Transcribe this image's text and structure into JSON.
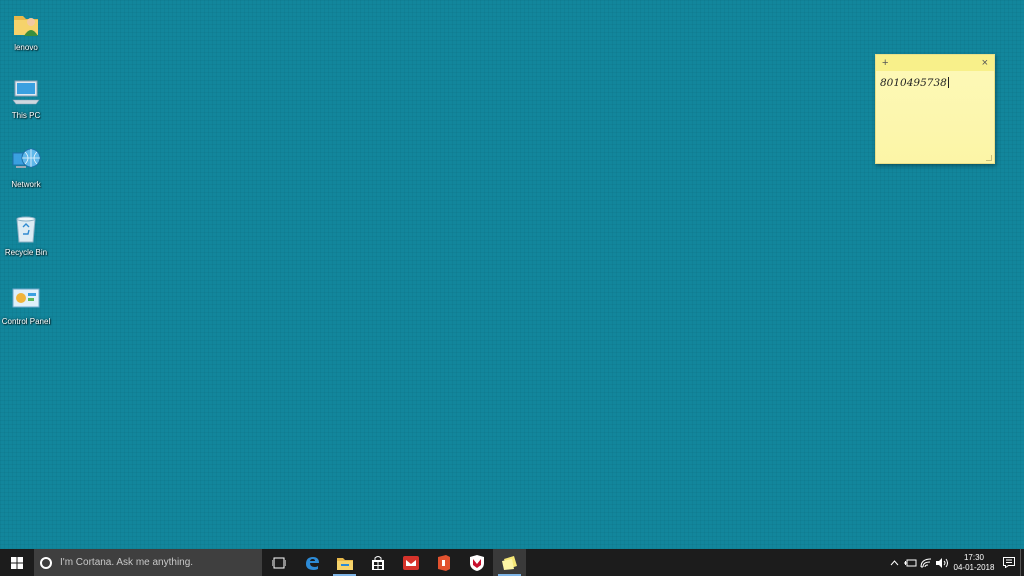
{
  "desktop": {
    "icons": [
      {
        "label": "lenovo"
      },
      {
        "label": "This PC"
      },
      {
        "label": "Network"
      },
      {
        "label": "Recycle Bin"
      },
      {
        "label": "Control Panel"
      }
    ]
  },
  "sticky_note": {
    "add_label": "+",
    "close_label": "×",
    "content": "8010495738"
  },
  "taskbar": {
    "cortana_placeholder": "I'm Cortana. Ask me anything.",
    "apps": [
      "task-view",
      "edge",
      "file-explorer",
      "store",
      "mail",
      "office",
      "mcafee",
      "sticky-notes"
    ],
    "tray": {
      "time": "17:30",
      "date": "04-01-2018"
    }
  },
  "colors": {
    "desktop_bg": "#12869c",
    "taskbar_bg": "#1c1c1c",
    "sticky_bg": "#fcf5a6"
  }
}
